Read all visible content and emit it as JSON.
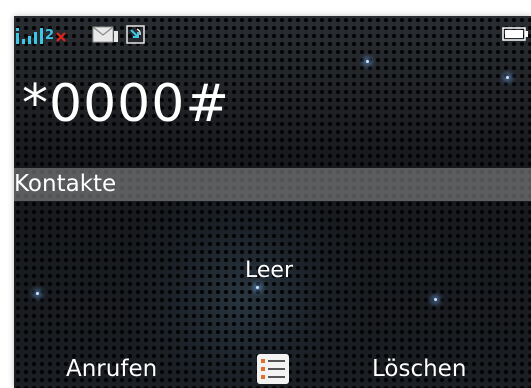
{
  "status_bar": {
    "icons": [
      "signal-strength-icon",
      "network-2-icon",
      "no-connection-icon",
      "message-icon",
      "missed-call-icon",
      "battery-icon"
    ],
    "network_indicator": "2",
    "colors": {
      "signal": "#3ec6e6",
      "no_connection": "#e0231c",
      "battery": "#ffffff"
    }
  },
  "dialer": {
    "entered_number": "*0000#"
  },
  "contacts_bar": {
    "label": "Kontakte"
  },
  "results": {
    "empty_text": "Leer"
  },
  "softkeys": {
    "left_label": "Anrufen",
    "center_icon": "menu-list-icon",
    "right_label": "Löschen"
  }
}
